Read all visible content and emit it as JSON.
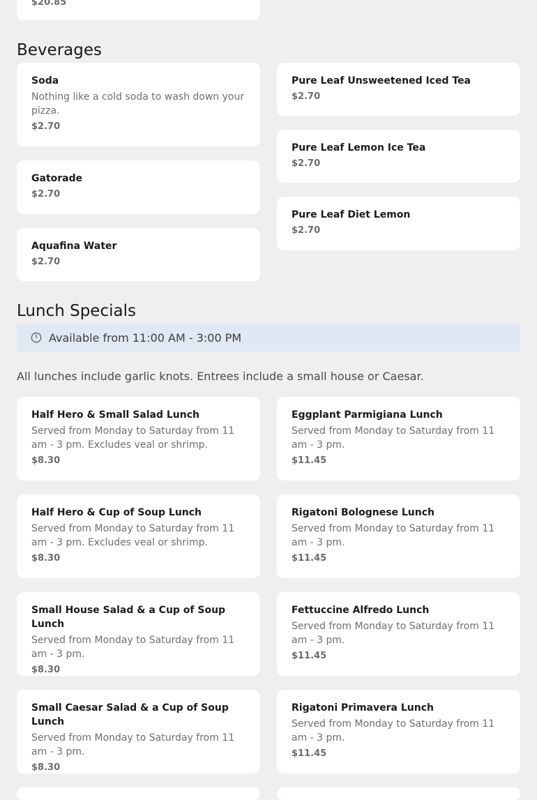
{
  "top_partial": {
    "price": "$20.85"
  },
  "beverages": {
    "title": "Beverages",
    "items": [
      {
        "name": "Soda",
        "description": "Nothing like a cold soda to wash down your pizza.",
        "price": "$2.70"
      },
      {
        "name": "Gatorade",
        "price": "$2.70"
      },
      {
        "name": "Aquafina Water",
        "price": "$2.70"
      },
      {
        "name": "Pure Leaf Unsweetened Iced Tea",
        "price": "$2.70"
      },
      {
        "name": "Pure Leaf Lemon Ice Tea",
        "price": "$2.70"
      },
      {
        "name": "Pure Leaf Diet Lemon",
        "price": "$2.70"
      }
    ]
  },
  "lunch": {
    "title": "Lunch Specials",
    "availability": "Available from 11:00 AM - 3:00 PM",
    "availability_icon": "clock-icon",
    "note": "All lunches include garlic knots. Entrees include a small house or Caesar.",
    "items": [
      {
        "name": "Half Hero & Small Salad Lunch",
        "description": "Served from Monday to Saturday from 11 am - 3 pm. Excludes veal or shrimp.",
        "price": "$8.30"
      },
      {
        "name": "Eggplant Parmigiana Lunch",
        "description": "Served from Monday to Saturday from 11 am - 3 pm.",
        "price": "$11.45"
      },
      {
        "name": "Half Hero & Cup of Soup Lunch",
        "description": "Served from Monday to Saturday from 11 am - 3 pm. Excludes veal or shrimp.",
        "price": "$8.30"
      },
      {
        "name": "Rigatoni Bolognese Lunch",
        "description": "Served from Monday to Saturday from 11 am - 3 pm.",
        "price": "$11.45"
      },
      {
        "name": "Small House Salad & a Cup of Soup Lunch",
        "description": "Served from Monday to Saturday from 11 am - 3 pm.",
        "price": "$8.30"
      },
      {
        "name": "Fettuccine Alfredo Lunch",
        "description": "Served from Monday to Saturday from 11 am - 3 pm.",
        "price": "$11.45"
      },
      {
        "name": "Small Caesar Salad & a Cup of Soup Lunch",
        "description": "Served from Monday to Saturday from 11 am - 3 pm.",
        "price": "$8.30"
      },
      {
        "name": "Rigatoni Primavera Lunch",
        "description": "Served from Monday to Saturday from 11 am - 3 pm.",
        "price": "$11.45"
      }
    ]
  },
  "colors": {
    "page_background": "#efefef",
    "card_background": "#ffffff",
    "availability_background": "#dfe8f3"
  }
}
